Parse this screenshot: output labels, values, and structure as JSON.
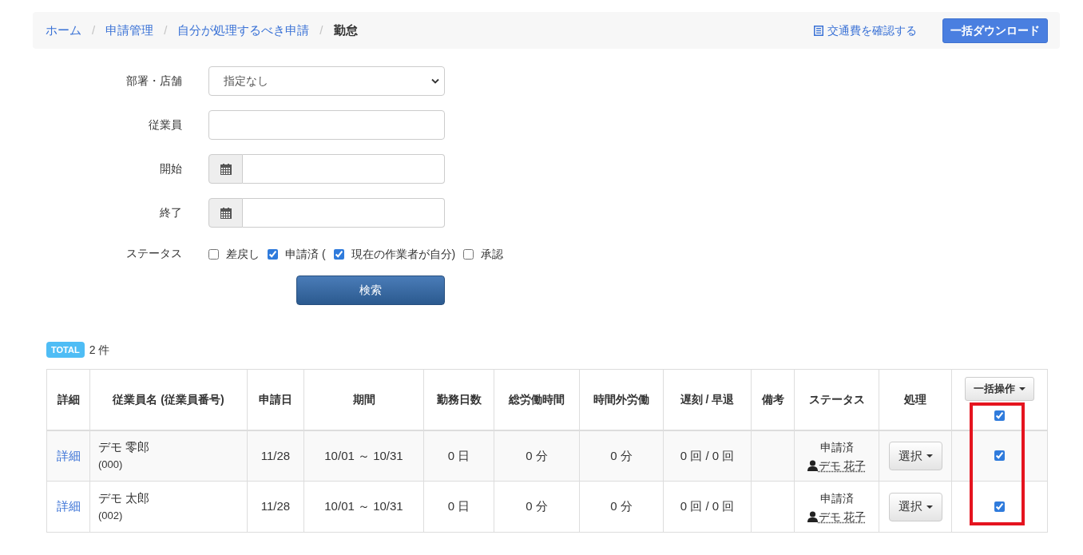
{
  "breadcrumb": [
    {
      "label": "ホーム",
      "current": false
    },
    {
      "label": "申請管理",
      "current": false,
      "separator": "/"
    },
    {
      "label": "自分が処理するべき申請",
      "current": false,
      "separator": "/"
    },
    {
      "label": "勤怠",
      "current": true,
      "separator": "/"
    }
  ],
  "header_actions": {
    "link": "交通費を確認する",
    "button": "一括ダウンロード"
  },
  "filters": [
    {
      "kind": "select",
      "label": "部署・店舗",
      "value": "指定なし"
    },
    {
      "kind": "text",
      "label": "従業員"
    },
    {
      "kind": "date",
      "label": "開始"
    },
    {
      "kind": "date",
      "label": "終了"
    }
  ],
  "status_filter": {
    "label": "ステータス",
    "options": [
      {
        "label": "差戻し",
        "checked": false
      },
      {
        "label": "申請済 (",
        "checked": true
      },
      {
        "label": "現在の作業者が自分)",
        "checked": true
      },
      {
        "label": "承認",
        "checked": false
      }
    ]
  },
  "search_button": "検索",
  "total": {
    "badge": "TOTAL",
    "count": "2 件"
  },
  "table": {
    "columns": [
      "詳細",
      "従業員名 (従業員番号)",
      "申請日",
      "期間",
      "勤務日数",
      "総労働時間",
      "時間外労働",
      "遅刻 / 早退",
      "備考",
      "ステータス",
      "処理"
    ],
    "bulk_button": "一括操作",
    "select_all": true,
    "rows": [
      {
        "detail": "詳細",
        "name": "デモ 零郎",
        "number": "(000)",
        "applied_on": "11/28",
        "period": "10/01 ～ 10/31",
        "work_days": "0 日",
        "total_hours": "0 分",
        "overtime": "0 分",
        "late_early": "0 回 / 0 回",
        "status": "申請済",
        "assignee": "デモ 花子",
        "action": "選択",
        "checked": true
      },
      {
        "detail": "詳細",
        "name": "デモ 太郎",
        "number": "(002)",
        "applied_on": "11/28",
        "period": "10/01 ～ 10/31",
        "work_days": "0 日",
        "total_hours": "0 分",
        "overtime": "0 分",
        "late_early": "0 回 / 0 回",
        "status": "申請済",
        "assignee": "デモ 花子",
        "action": "選択",
        "checked": true
      }
    ]
  }
}
